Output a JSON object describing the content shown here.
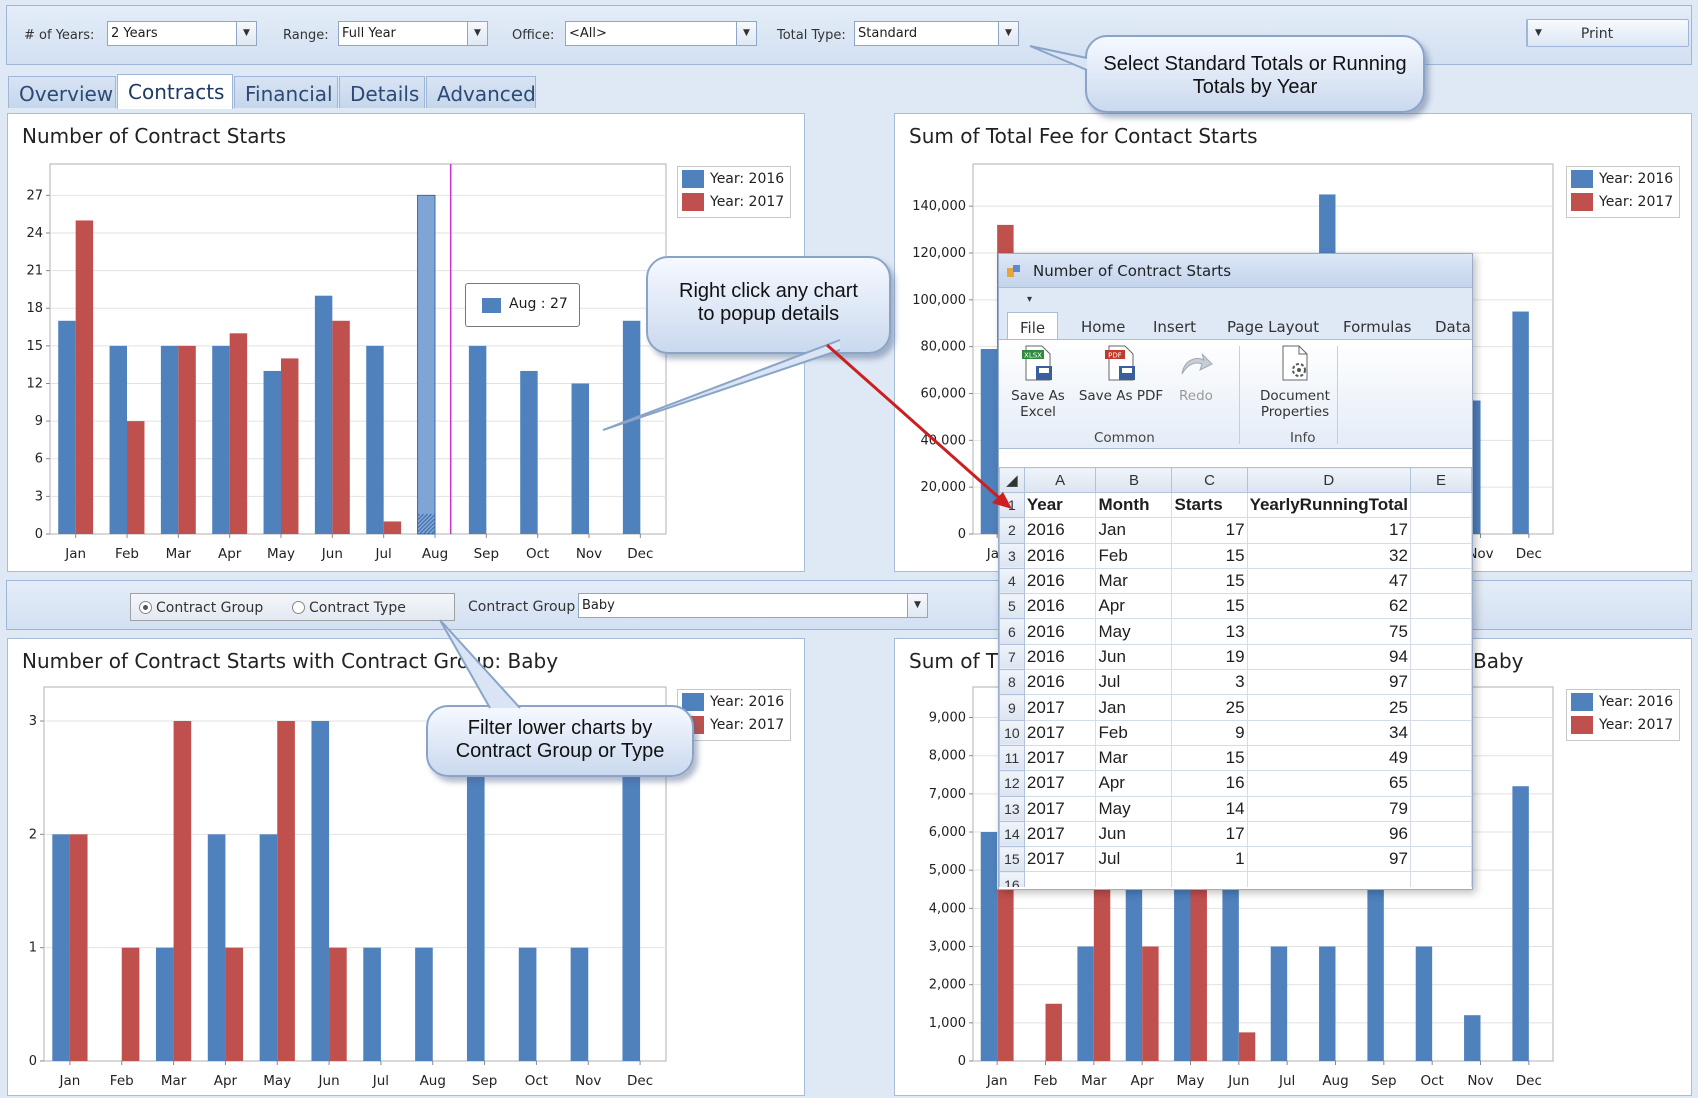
{
  "toolbar": {
    "years_label": "# of Years:",
    "years_value": "2 Years",
    "range_label": "Range:",
    "range_value": "Full Year",
    "office_label": "Office:",
    "office_value": "<All>",
    "total_type_label": "Total Type:",
    "total_type_value": "Standard",
    "print_label": "Print"
  },
  "tabs": [
    "Overview",
    "Contracts",
    "Financial",
    "Details",
    "Advanced"
  ],
  "active_tab": "Contracts",
  "legend": {
    "y2016": "Year: 2016",
    "y2017": "Year: 2017"
  },
  "colors": {
    "y2016": "#4f81bd",
    "y2017": "#c0504d",
    "hover_line": "#cc33cc"
  },
  "filter": {
    "radio_group_label": "Contract Group",
    "radio_type_label": "Contract Type",
    "selected_radio": "Contract Group",
    "group_label": "Contract Group",
    "group_value": "Baby"
  },
  "callouts": {
    "totals": "Select Standard Totals or Running Totals by Year",
    "right_click": "Right click any chart to popup details",
    "filter": "Filter lower charts by Contract Group or Type"
  },
  "tooltip": {
    "text": "Aug : 27"
  },
  "popup": {
    "title": "Number of Contract Starts",
    "qat_symbol": "▾",
    "ribbon_tabs": [
      "File",
      "Home",
      "Insert",
      "Page Layout",
      "Formulas",
      "Data"
    ],
    "active_ribbon_tab": "File",
    "buttons": {
      "save_excel_1": "Save As",
      "save_excel_2": "Excel",
      "save_pdf": "Save As PDF",
      "redo": "Redo",
      "doc_props_1": "Document",
      "doc_props_2": "Properties"
    },
    "icon_texts": {
      "xlsx": "XLSX",
      "pdf": "PDF"
    },
    "groups": {
      "common": "Common",
      "info": "Info"
    },
    "columns": [
      "A",
      "B",
      "C",
      "D",
      "E"
    ],
    "rows": [
      {
        "n": "1",
        "a": "Year",
        "b": "Month",
        "c": "Starts",
        "d": "YearlyRunningTotal"
      },
      {
        "n": "2",
        "a": "2016",
        "b": "Jan",
        "c": "17",
        "d": "17"
      },
      {
        "n": "3",
        "a": "2016",
        "b": "Feb",
        "c": "15",
        "d": "32"
      },
      {
        "n": "4",
        "a": "2016",
        "b": "Mar",
        "c": "15",
        "d": "47"
      },
      {
        "n": "5",
        "a": "2016",
        "b": "Apr",
        "c": "15",
        "d": "62"
      },
      {
        "n": "6",
        "a": "2016",
        "b": "May",
        "c": "13",
        "d": "75"
      },
      {
        "n": "7",
        "a": "2016",
        "b": "Jun",
        "c": "19",
        "d": "94"
      },
      {
        "n": "8",
        "a": "2016",
        "b": "Jul",
        "c": "3",
        "d": "97"
      },
      {
        "n": "9",
        "a": "2017",
        "b": "Jan",
        "c": "25",
        "d": "25"
      },
      {
        "n": "10",
        "a": "2017",
        "b": "Feb",
        "c": "9",
        "d": "34"
      },
      {
        "n": "11",
        "a": "2017",
        "b": "Mar",
        "c": "15",
        "d": "49"
      },
      {
        "n": "12",
        "a": "2017",
        "b": "Apr",
        "c": "16",
        "d": "65"
      },
      {
        "n": "13",
        "a": "2017",
        "b": "May",
        "c": "14",
        "d": "79"
      },
      {
        "n": "14",
        "a": "2017",
        "b": "Jun",
        "c": "17",
        "d": "96"
      },
      {
        "n": "15",
        "a": "2017",
        "b": "Jul",
        "c": "1",
        "d": "97"
      },
      {
        "n": "16",
        "a": "",
        "b": "",
        "c": "",
        "d": ""
      }
    ]
  },
  "chart_data": [
    {
      "type": "bar",
      "title": "Number of Contract Starts",
      "categories": [
        "Jan",
        "Feb",
        "Mar",
        "Apr",
        "May",
        "Jun",
        "Jul",
        "Aug",
        "Sep",
        "Oct",
        "Nov",
        "Dec"
      ],
      "series": [
        {
          "name": "Year: 2016",
          "values": [
            17,
            15,
            15,
            15,
            13,
            19,
            15,
            27,
            15,
            13,
            12,
            17
          ]
        },
        {
          "name": "Year: 2017",
          "values": [
            25,
            9,
            15,
            16,
            14,
            17,
            1,
            null,
            null,
            null,
            null,
            null
          ]
        }
      ],
      "yticks": [
        0,
        3,
        6,
        9,
        12,
        15,
        18,
        21,
        24,
        27
      ],
      "ytick_labels": [
        "0",
        "3",
        "6",
        "9",
        "12",
        "15",
        "18",
        "21",
        "24",
        "27"
      ],
      "ylim": [
        0,
        29.5
      ],
      "highlight": {
        "category": "Aug",
        "series": 0
      },
      "legend": "top-right"
    },
    {
      "type": "bar",
      "title": "Sum of Total Fee for Contact Starts",
      "categories": [
        "Jan",
        "Feb",
        "Mar",
        "Apr",
        "May",
        "Jun",
        "Jul",
        "Aug",
        "Sep",
        "Oct",
        "Nov",
        "Dec"
      ],
      "series": [
        {
          "name": "Year: 2016",
          "values": [
            79000,
            null,
            null,
            null,
            null,
            null,
            null,
            145000,
            null,
            null,
            57000,
            95000
          ]
        },
        {
          "name": "Year: 2017",
          "values": [
            132000,
            null,
            null,
            null,
            null,
            null,
            null,
            null,
            null,
            null,
            null,
            null
          ]
        }
      ],
      "yticks": [
        0,
        20000,
        40000,
        60000,
        80000,
        100000,
        120000,
        140000
      ],
      "ytick_labels": [
        "0",
        "20,000",
        "40,000",
        "60,000",
        "80,000",
        "100,000",
        "120,000",
        "140,000"
      ],
      "ylim": [
        0,
        158000
      ],
      "legend": "top-right"
    },
    {
      "type": "bar",
      "title": "Number of Contract Starts with Contract Group: Baby",
      "categories": [
        "Jan",
        "Feb",
        "Mar",
        "Apr",
        "May",
        "Jun",
        "Jul",
        "Aug",
        "Sep",
        "Oct",
        "Nov",
        "Dec"
      ],
      "series": [
        {
          "name": "Year: 2016",
          "values": [
            2,
            0,
            1,
            2,
            2,
            3,
            1,
            1,
            3,
            1,
            1,
            3
          ]
        },
        {
          "name": "Year: 2017",
          "values": [
            2,
            1,
            3,
            1,
            3,
            1,
            null,
            null,
            null,
            null,
            null,
            null
          ]
        }
      ],
      "yticks": [
        0,
        1,
        2,
        3
      ],
      "ytick_labels": [
        "0",
        "1",
        "2",
        "3"
      ],
      "ylim": [
        0,
        3.3
      ],
      "legend": "top-right"
    },
    {
      "type": "bar",
      "title": "Sum of T",
      "title_tail": "Baby",
      "categories": [
        "Jan",
        "Feb",
        "Mar",
        "Apr",
        "May",
        "Jun",
        "Jul",
        "Aug",
        "Sep",
        "Oct",
        "Nov",
        "Dec"
      ],
      "series": [
        {
          "name": "Year: 2016",
          "values": [
            6000,
            0,
            3000,
            4500,
            4500,
            4500,
            3000,
            3000,
            4500,
            3000,
            1200,
            7200
          ]
        },
        {
          "name": "Year: 2017",
          "values": [
            4500,
            1500,
            4500,
            3000,
            4500,
            750,
            null,
            null,
            null,
            null,
            null,
            null
          ]
        }
      ],
      "yticks": [
        0,
        1000,
        2000,
        3000,
        4000,
        5000,
        6000,
        7000,
        8000,
        9000
      ],
      "ytick_labels": [
        "0",
        "1,000",
        "2,000",
        "3,000",
        "4,000",
        "5,000",
        "6,000",
        "7,000",
        "8,000",
        "9,000"
      ],
      "ylim": [
        0,
        9800
      ],
      "legend": "top-right"
    }
  ]
}
